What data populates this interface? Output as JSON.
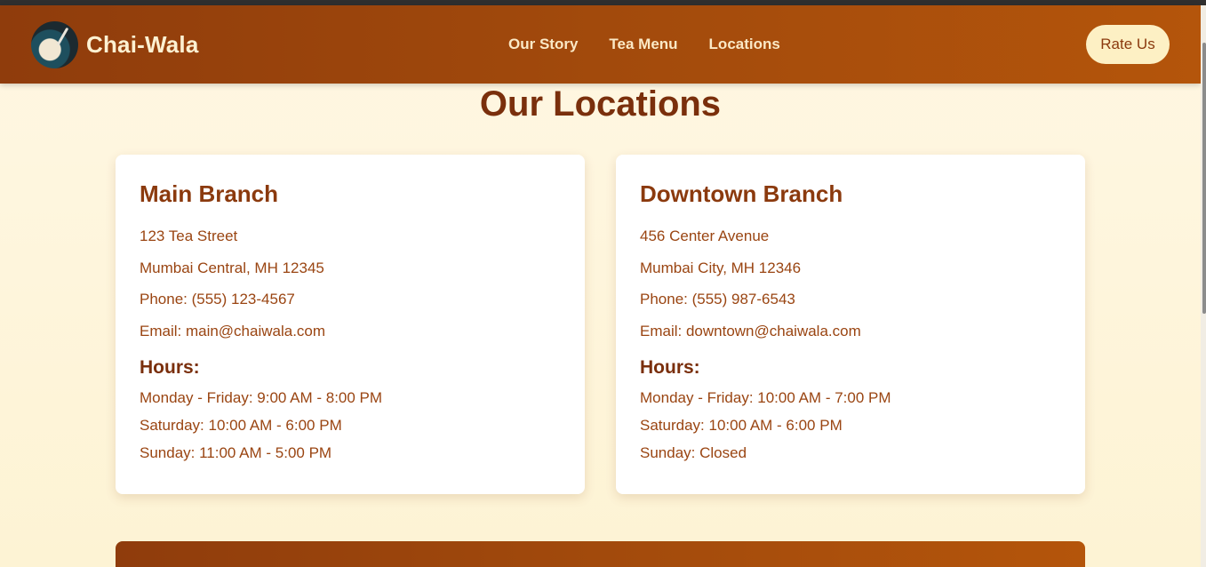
{
  "brand": {
    "name": "Chai-Wala",
    "logo_icon": "tea-cup-logo-icon"
  },
  "nav": {
    "items": [
      {
        "label": "Our Story"
      },
      {
        "label": "Tea Menu"
      },
      {
        "label": "Locations"
      }
    ],
    "rate_button": "Rate Us"
  },
  "page": {
    "title": "Our Locations"
  },
  "locations": [
    {
      "name": "Main Branch",
      "address_line1": "123 Tea Street",
      "address_line2": "Mumbai Central, MH 12345",
      "phone": "Phone: (555) 123-4567",
      "email": "Email: main@chaiwala.com",
      "hours_title": "Hours:",
      "hours": [
        "Monday - Friday: 9:00 AM - 8:00 PM",
        "Saturday: 10:00 AM - 6:00 PM",
        "Sunday: 11:00 AM - 5:00 PM"
      ]
    },
    {
      "name": "Downtown Branch",
      "address_line1": "456 Center Avenue",
      "address_line2": "Mumbai City, MH 12346",
      "phone": "Phone: (555) 987-6543",
      "email": "Email: downtown@chaiwala.com",
      "hours_title": "Hours:",
      "hours": [
        "Monday - Friday: 10:00 AM - 7:00 PM",
        "Saturday: 10:00 AM - 6:00 PM",
        "Sunday: Closed"
      ]
    }
  ],
  "colors": {
    "brand_brown": "#8f3c0c",
    "brand_orange": "#b4550b",
    "cream": "#fdf0c4",
    "text_brown": "#8b3a0e"
  }
}
